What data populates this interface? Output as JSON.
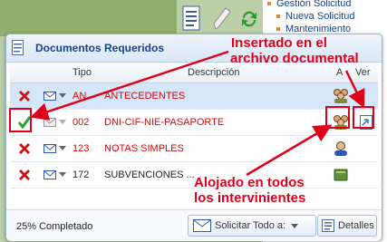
{
  "background": {
    "tree": [
      "Gestión Solicitud",
      "Nueva Solicitud",
      "Mantenimiento"
    ]
  },
  "window": {
    "title": "Documentos Requeridos",
    "columns": {
      "tipo": "Tipo",
      "descripcion": "Descripción",
      "a": "A",
      "ver": "Ver"
    },
    "rows": [
      {
        "status": "missing",
        "tipo": "AN",
        "descripcion": "ANTECEDENTES",
        "color": "red",
        "mail_active": true,
        "a_icon": "people-group-icon",
        "ver": false,
        "selected": true
      },
      {
        "status": "ok",
        "tipo": "002",
        "descripcion": "DNI-CIF-NIE-PASAPORTE",
        "color": "red",
        "mail_active": false,
        "a_icon": "people-group-icon",
        "ver": true,
        "selected": false
      },
      {
        "status": "missing",
        "tipo": "123",
        "descripcion": "NOTAS SIMPLES",
        "color": "red",
        "mail_active": true,
        "a_icon": "person-icon",
        "ver": false,
        "selected": false
      },
      {
        "status": "missing",
        "tipo": "172",
        "descripcion": "SUBVENCIONES ...",
        "color": "dark",
        "mail_active": true,
        "a_icon": "book-icon",
        "ver": false,
        "selected": false
      }
    ],
    "footer": {
      "progress_text": "25% Completado",
      "progress_value": 0.25,
      "request_all_label": "Solicitar Todo a:",
      "details_label": "Detalles"
    }
  },
  "annotations": {
    "top_line1": "Insertado en el",
    "top_line2": "archivo documental",
    "bottom_line1": "Alojado en todos",
    "bottom_line2": "los intervinientes"
  },
  "colors": {
    "accent_red": "#e0001a",
    "title_blue": "#15428b"
  }
}
